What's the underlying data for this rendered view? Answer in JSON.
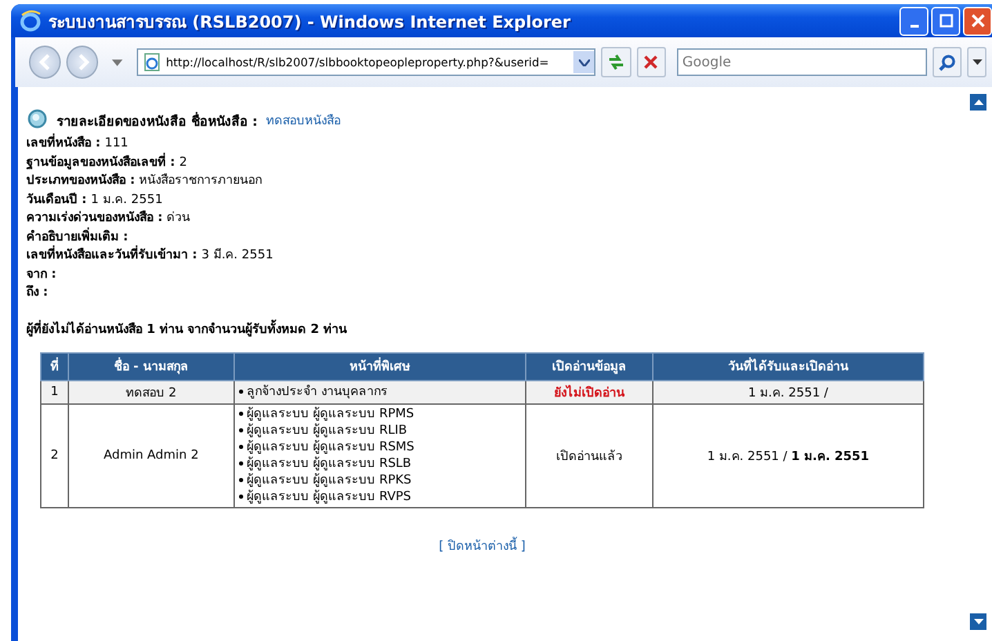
{
  "window": {
    "title": "ระบบงานสารบรรณ (RSLB2007) - Windows Internet Explorer"
  },
  "toolbar": {
    "address": "http://localhost/R/slb2007/slbbooktopeopleproperty.php?&userid=",
    "search_placeholder": "Google"
  },
  "heading": {
    "label": "รายละเอียดของหนังสือ ชื่อหนังสือ :",
    "link": "ทดสอบหนังสือ"
  },
  "details": [
    {
      "label": "เลขที่หนังสือ :",
      "value": "111"
    },
    {
      "label": "ฐานข้อมูลของหนังสือเลขที่ :",
      "value": "2"
    },
    {
      "label": "ประเภทของหนังสือ :",
      "value": "หนังสือราชการภายนอก"
    },
    {
      "label": "วันเดือนปี :",
      "value": "1 ม.ค. 2551"
    },
    {
      "label": "ความเร่งด่วนของหนังสือ :",
      "value": "ด่วน"
    },
    {
      "label": "คำอธิบายเพิ่มเติม :"
    },
    {
      "label": "เลขที่หนังสือและวันที่รับเข้ามา :",
      "value": "3 มี.ค. 2551"
    },
    {
      "label": "จาก :"
    },
    {
      "label": "ถึง :"
    }
  ],
  "summary": "ผู้ที่ยังไม่ได้อ่านหนังสือ 1 ท่าน จากจำนวนผู้รับทั้งหมด 2 ท่าน",
  "table": {
    "columns": [
      "ที่",
      "ชื่อ - นามสกุล",
      "หน้าที่พิเศษ",
      "เปิดอ่านข้อมูล",
      "วันที่ได้รับและเปิดอ่าน"
    ],
    "rows": [
      {
        "no": "1",
        "name": "ทดสอบ 2",
        "duties": [
          "ลูกจ้างประจำ งานบุคลากร"
        ],
        "status": "ยังไม่เปิดอ่าน",
        "read": false,
        "date": "1 ม.ค. 2551 /"
      },
      {
        "no": "2",
        "name": "Admin Admin 2",
        "duties": [
          "ผู้ดูแลระบบ ผู้ดูแลระบบ RPMS",
          "ผู้ดูแลระบบ ผู้ดูแลระบบ RLIB",
          "ผู้ดูแลระบบ ผู้ดูแลระบบ RSMS",
          "ผู้ดูแลระบบ ผู้ดูแลระบบ RSLB",
          "ผู้ดูแลระบบ ผู้ดูแลระบบ RPKS",
          "ผู้ดูแลระบบ ผู้ดูแลระบบ RVPS"
        ],
        "status": "เปิดอ่านแล้ว",
        "read": true,
        "date": "1 ม.ค. 2551 / **1 ม.ค. 2551**"
      }
    ]
  },
  "close_link": "[ ปิดหน้าต่างนี้ ]"
}
